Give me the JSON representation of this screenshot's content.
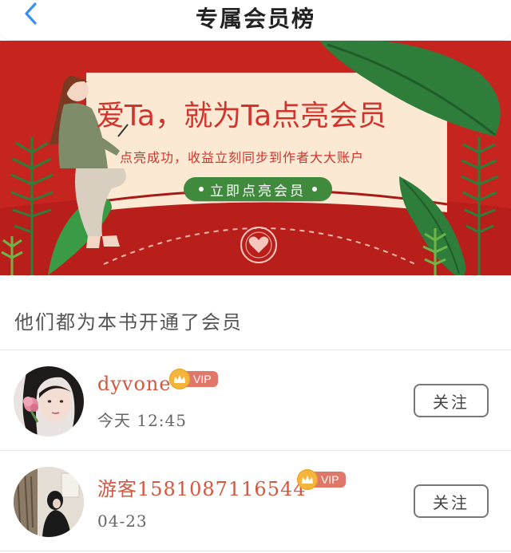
{
  "header": {
    "title": "专属会员榜",
    "back_icon": "chevron-left-icon",
    "accent": "#3b8ff0"
  },
  "banner": {
    "headline": "爱Ta，就为Ta点亮会员",
    "subtitle": "点亮成功，收益立刻同步到作者大大账户",
    "cta_label": "立即点亮会员",
    "colors": {
      "background": "#c5241f",
      "card": "#fbe9d4",
      "text": "#d0342c",
      "button": "#3f8a3c",
      "leaf": "#2f7d3a"
    }
  },
  "section": {
    "title": "他们都为本书开通了会员"
  },
  "members": [
    {
      "name": "dyvone",
      "badge": "VIP",
      "time": "今天 12:45",
      "follow_label": "关注",
      "avatar": "avatar-girl-with-flower"
    },
    {
      "name": "游客15810871165​44",
      "badge": "VIP",
      "time": "04-23",
      "follow_label": "关注",
      "avatar": "avatar-girl-in-room"
    }
  ]
}
